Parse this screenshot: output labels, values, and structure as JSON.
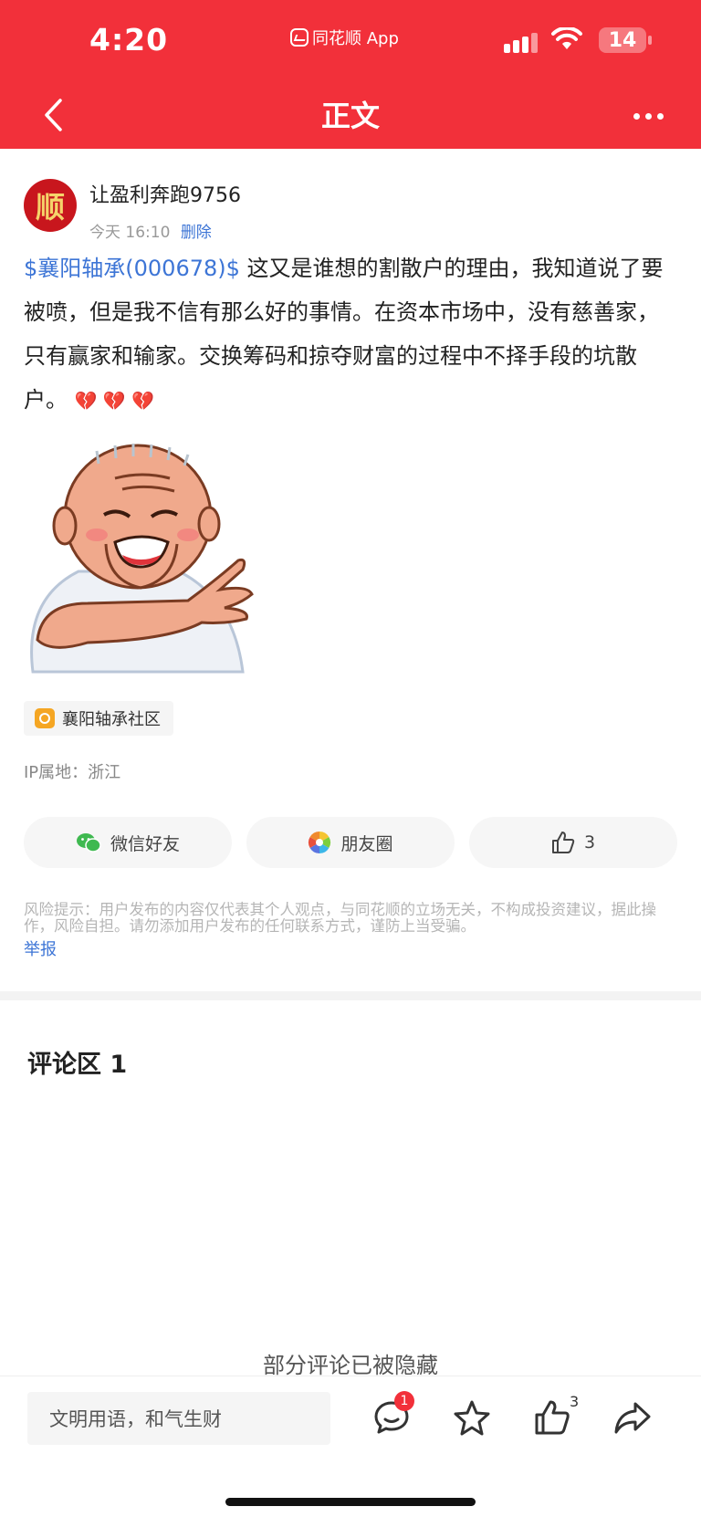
{
  "status_bar": {
    "time": "4:20",
    "app_indicator": "同花顺 App",
    "battery": "14"
  },
  "nav": {
    "title": "正文",
    "back_icon": "chevron-left-icon",
    "more_icon": "more-dots-icon"
  },
  "author": {
    "avatar_char": "顺",
    "name": "让盈利奔跑9756",
    "time": "今天 16:10",
    "delete_label": "删除"
  },
  "post": {
    "stock_tag": "$襄阳轴承(000678)$",
    "text": " 这又是谁想的割散户的理由，我知道说了要被喷，但是我不信有那么好的事情。在资本市场中，没有慈善家，只有赢家和输家。交换筹码和掠夺财富的过程中不择手段的坑散户。",
    "emojis": "💔 💔 💔"
  },
  "community_tag": "襄阳轴承社区",
  "ip_location": "IP属地：浙江",
  "share": {
    "wechat_label": "微信好友",
    "moments_label": "朋友圈",
    "like_count": "3"
  },
  "risk_notice": "风险提示：用户发布的内容仅代表其个人观点，与同花顺的立场无关，不构成投资建议，据此操作，风险自担。请勿添加用户发布的任何联系方式，谨防上当受骗。",
  "report_label": "举报",
  "comments": {
    "title": "评论区 1",
    "hidden_note": "部分评论已被隐藏"
  },
  "bottom_bar": {
    "input_placeholder": "文明用语，和气生财",
    "comment_badge": "1",
    "like_count": "3"
  },
  "colors": {
    "brand_red": "#f2303a",
    "link_blue": "#3d75d6"
  }
}
